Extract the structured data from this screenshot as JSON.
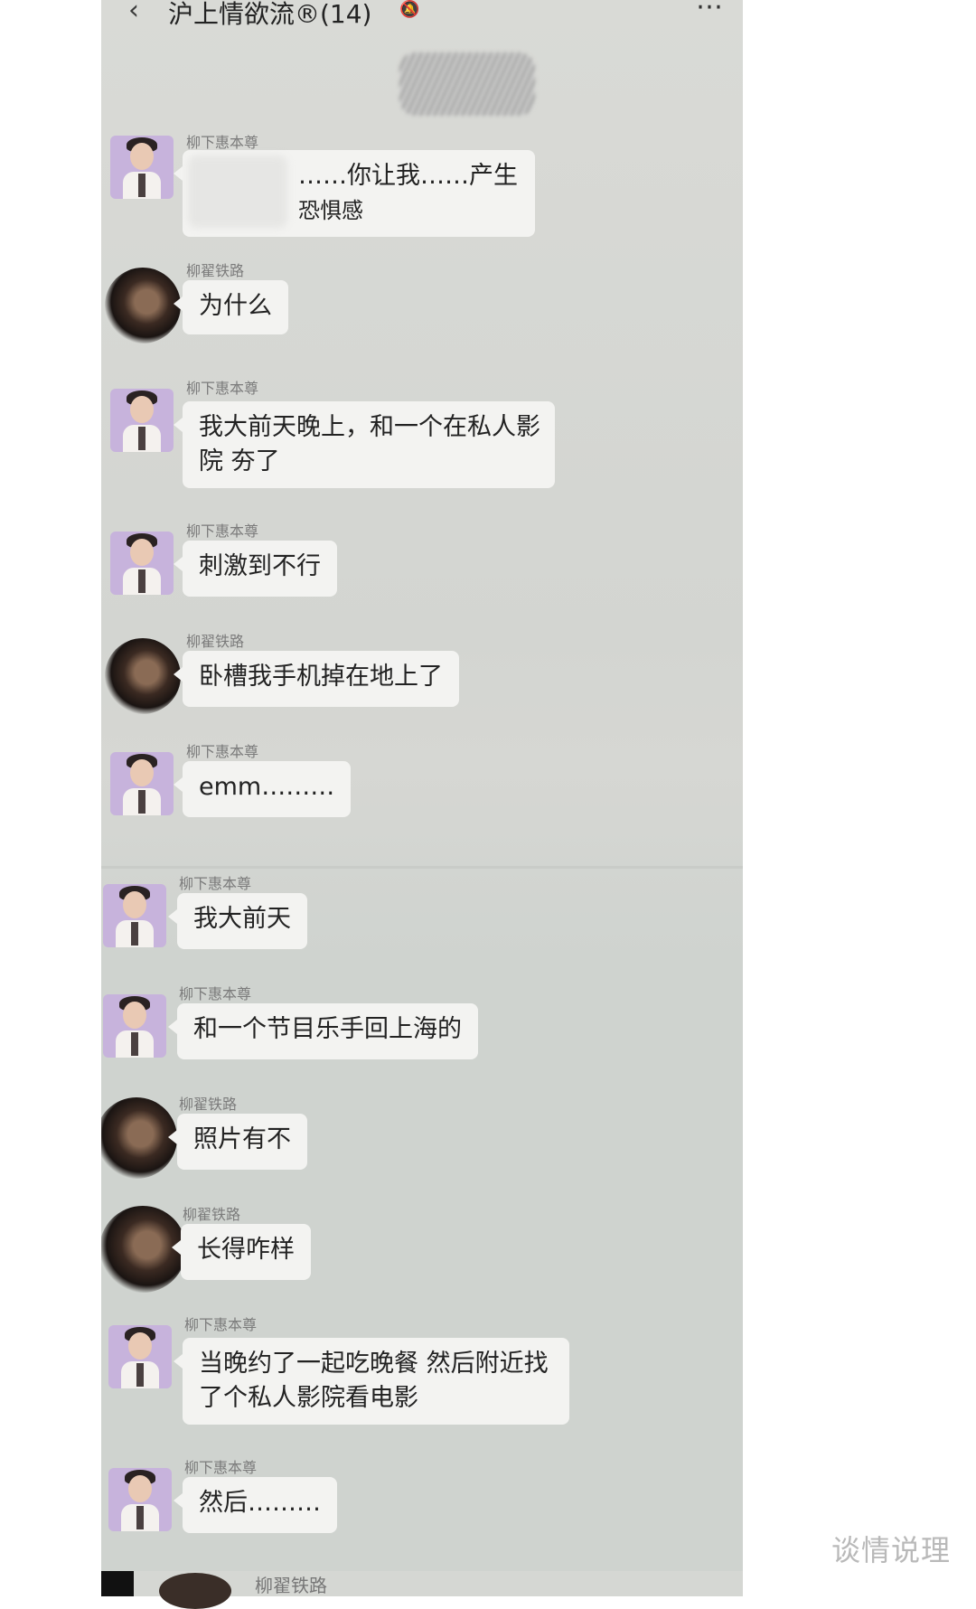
{
  "header": {
    "title": "沪上情欲流®(14)",
    "more_icon": "⋯"
  },
  "messages": [
    {
      "sender": "柳下惠本尊",
      "text_line1": "……你让我……产生",
      "text_line2": "恐惧感"
    },
    {
      "sender": "柳翟铁路",
      "text": "为什么"
    },
    {
      "sender": "柳下惠本尊",
      "text_line1": "我大前天晚上，和一个在私人影",
      "text_line2": "院 夯了"
    },
    {
      "sender": "柳下惠本尊",
      "text": "刺激到不行"
    },
    {
      "sender": "柳翟铁路",
      "text": "卧槽我手机掉在地上了"
    },
    {
      "sender": "柳下惠本尊",
      "text": "emm………"
    },
    {
      "sender": "柳下惠本尊",
      "text": "我大前天"
    },
    {
      "sender": "柳下惠本尊",
      "text": "和一个节目乐手回上海的"
    },
    {
      "sender": "柳翟铁路",
      "text": "照片有不"
    },
    {
      "sender": "柳翟铁路",
      "text": "长得咋样"
    },
    {
      "sender": "柳下惠本尊",
      "text_line1": "当晚约了一起吃晚餐 然后附近找",
      "text_line2": "了个私人影院看电影"
    },
    {
      "sender": "柳下惠本尊",
      "text": "然后………"
    },
    {
      "sender": "柳翟铁路"
    }
  ],
  "watermark": "谈情说理"
}
